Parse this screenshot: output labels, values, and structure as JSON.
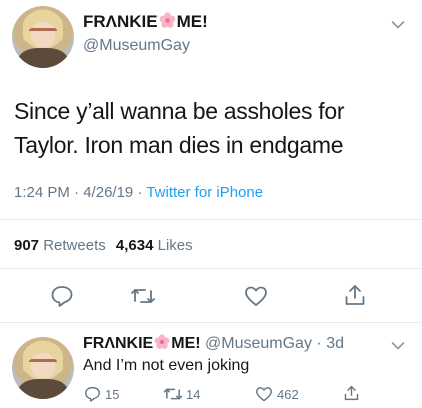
{
  "main_tweet": {
    "display_name_part1": "FRΛNKIE",
    "display_name_part2": "ME!",
    "handle": "@MuseumGay",
    "text": "Since y’all wanna be assholes for Taylor. Iron man dies in endgame",
    "time": "1:24 PM",
    "date": "4/26/19",
    "dot": "·",
    "source": "Twitter for iPhone",
    "retweets_count": "907",
    "retweets_label": "Retweets",
    "likes_count": "4,634",
    "likes_label": "Likes"
  },
  "reply_tweet": {
    "display_name_part1": "FRΛNKIE",
    "display_name_part2": "ME!",
    "handle": "@MuseumGay",
    "dot": "·",
    "age": "3d",
    "text": "And I’m not even joking",
    "reply_count": "15",
    "retweet_count": "14",
    "like_count": "462"
  },
  "icons": {
    "menu": "chevron-down-icon",
    "reply": "reply-icon",
    "retweet": "retweet-icon",
    "like": "heart-icon",
    "share": "share-icon",
    "emoji": "cherry-blossom-icon"
  },
  "colors": {
    "text": "#14171a",
    "muted": "#657786",
    "accent": "#1da1f2",
    "divider": "#e6ecf0"
  }
}
